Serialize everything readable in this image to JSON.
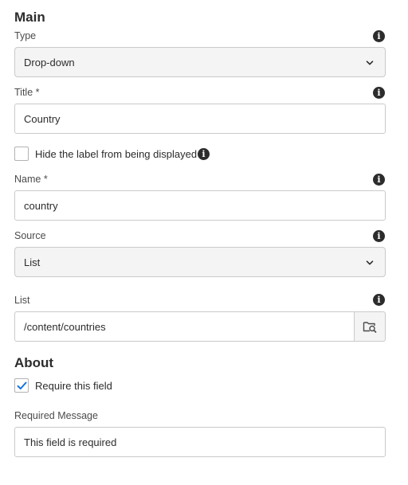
{
  "main": {
    "title": "Main",
    "type": {
      "label": "Type",
      "value": "Drop-down"
    },
    "title_field": {
      "label": "Title *",
      "value": "Country"
    },
    "hide_label": {
      "label": "Hide the label from being displayed",
      "checked": false
    },
    "name": {
      "label": "Name *",
      "value": "country"
    },
    "source": {
      "label": "Source",
      "value": "List"
    },
    "list": {
      "label": "List",
      "value": "/content/countries"
    }
  },
  "about": {
    "title": "About",
    "require_field": {
      "label": "Require this field",
      "checked": true
    },
    "required_message": {
      "label": "Required Message",
      "value": "This field is required"
    }
  },
  "colors": {
    "text": "#2c2c2c",
    "border": "#cacaca",
    "select_bg": "#f4f4f4",
    "check_accent": "#1473e6"
  },
  "icons": {
    "info": "info-icon",
    "chevron": "chevron-down-icon",
    "browse": "folder-search-icon",
    "check": "checkmark-icon"
  }
}
